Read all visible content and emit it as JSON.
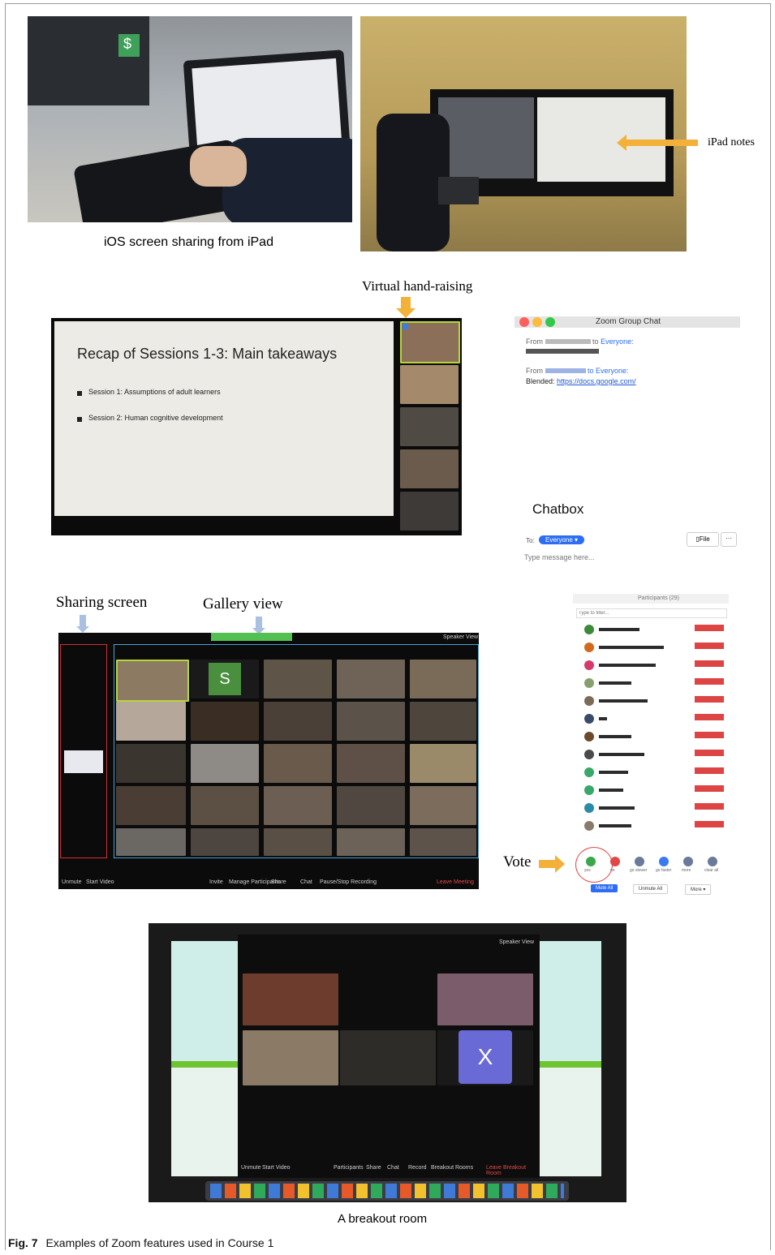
{
  "figure": {
    "label": "Fig. 7",
    "caption": "Examples of Zoom features used in Course 1"
  },
  "panel_a": {
    "caption_left": "iOS screen sharing from iPad",
    "annotation_right": "iPad notes"
  },
  "panel_b": {
    "annotation_top": "Virtual hand-raising",
    "slide_title": "Recap of Sessions 1-3: Main takeaways",
    "slide_bullets": [
      "Session 1: Assumptions of adult learners",
      "Session 2: Human cognitive development"
    ],
    "chat": {
      "window_title": "Zoom Group Chat",
      "msg1_prefix": "From",
      "msg1_to": "to",
      "msg1_target": "Everyone:",
      "msg2_prefix": "From",
      "msg2_target": "to Everyone:",
      "msg2_label": "Blended:",
      "msg2_link": "https://docs.google.com/",
      "chatbox_label": "Chatbox",
      "to_label": "To:",
      "to_selected": "Everyone ▾",
      "file_button": "File",
      "more_button": "···",
      "input_placeholder": "Type message here..."
    }
  },
  "panel_c": {
    "label_sharing": "Sharing screen",
    "label_gallery": "Gallery view",
    "label_vote": "Vote",
    "gallery_s_tile": "S",
    "participants_window_title": "Participants (29)",
    "participants_filter_placeholder": "Type to filter...",
    "vote_buttons": [
      "yes",
      "no",
      "go slower",
      "go faster",
      "more",
      "clear all"
    ],
    "mute_all": "Mute All",
    "unmute_all": "Unmute All",
    "more": "More ▾",
    "toolbar": [
      "Unmute",
      "Start Video",
      "Invite",
      "Manage Participants",
      "Share",
      "Chat",
      "Pause/Stop Recording"
    ],
    "leave": "Leave Meeting",
    "speaker_view": "Speaker View"
  },
  "panel_d": {
    "caption": "A breakout room",
    "x_tile": "X",
    "toolbar": [
      "Unmute",
      "Start Video",
      "Participants",
      "Share",
      "Chat",
      "Record",
      "Breakout Rooms"
    ],
    "leave": "Leave Breakout Room",
    "speaker_view": "Speaker View"
  }
}
